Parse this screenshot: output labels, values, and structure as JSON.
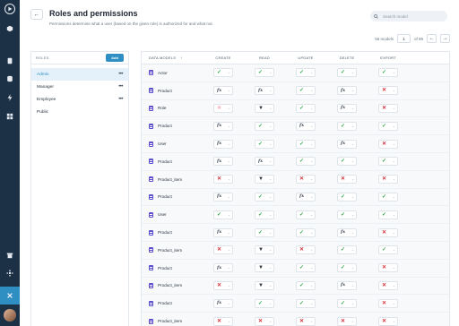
{
  "header": {
    "title": "Roles and permissions",
    "subtitle": "Permissions determine what a user (based on the given role) is authorized for and what not."
  },
  "search": {
    "placeholder": "Search model"
  },
  "pagination": {
    "count": "56 models",
    "page": "1",
    "of": "of 99"
  },
  "roles": {
    "label": "ROLES",
    "add_label": "Add",
    "items": [
      {
        "name": "Admin",
        "active": true,
        "menu": true
      },
      {
        "name": "Manager",
        "active": false,
        "menu": true
      },
      {
        "name": "Employee",
        "active": false,
        "menu": true
      },
      {
        "name": "Public",
        "active": false,
        "menu": false
      }
    ]
  },
  "table": {
    "columns": [
      "DATA MODELS",
      "CREATE",
      "READ",
      "UPDATE",
      "DELETE",
      "EXPORT"
    ],
    "rows": [
      {
        "model": "Actor",
        "perms": [
          "check",
          "check",
          "check",
          "check",
          "check"
        ]
      },
      {
        "model": "Product",
        "perms": [
          "fx",
          "fx",
          "check",
          "fx",
          "cross"
        ]
      },
      {
        "model": "Role",
        "perms": [
          "cross-light",
          "filter",
          "check",
          "fx",
          "cross"
        ]
      },
      {
        "model": "Product",
        "perms": [
          "fx",
          "check",
          "fx",
          "check",
          "check"
        ]
      },
      {
        "model": "User",
        "perms": [
          "fx",
          "check",
          "check",
          "fx",
          "cross"
        ]
      },
      {
        "model": "Product",
        "perms": [
          "fx",
          "fx",
          "check",
          "check",
          "check"
        ]
      },
      {
        "model": "Product_item",
        "perms": [
          "cross",
          "filter",
          "cross",
          "cross",
          "cross"
        ]
      },
      {
        "model": "Product",
        "perms": [
          "fx",
          "check",
          "fx",
          "check",
          "check"
        ]
      },
      {
        "model": "User",
        "perms": [
          "check",
          "check",
          "check",
          "check",
          "check"
        ]
      },
      {
        "model": "Product",
        "perms": [
          "fx",
          "check",
          "check",
          "fx",
          "cross"
        ]
      },
      {
        "model": "Product_item",
        "perms": [
          "cross",
          "filter",
          "cross",
          "check",
          "check"
        ]
      },
      {
        "model": "Product",
        "perms": [
          "fx",
          "filter",
          "check",
          "check",
          "cross"
        ]
      },
      {
        "model": "Product_item",
        "perms": [
          "cross",
          "filter",
          "check",
          "fx",
          "cross"
        ]
      },
      {
        "model": "Product",
        "perms": [
          "fx",
          "check",
          "check",
          "check",
          "cross"
        ]
      },
      {
        "model": "Product_item",
        "perms": [
          "cross",
          "cross",
          "cross",
          "cross",
          "cross"
        ]
      }
    ]
  },
  "colors": {
    "rail": "#1d3146",
    "accent": "#2f8fc3",
    "check": "#2ea84a",
    "cross": "#d6333f",
    "model_icon": "#5b4fcf"
  },
  "icons": {
    "check": "check-icon",
    "cross": "cross-icon",
    "fx": "function-icon",
    "filter": "filter-icon"
  }
}
